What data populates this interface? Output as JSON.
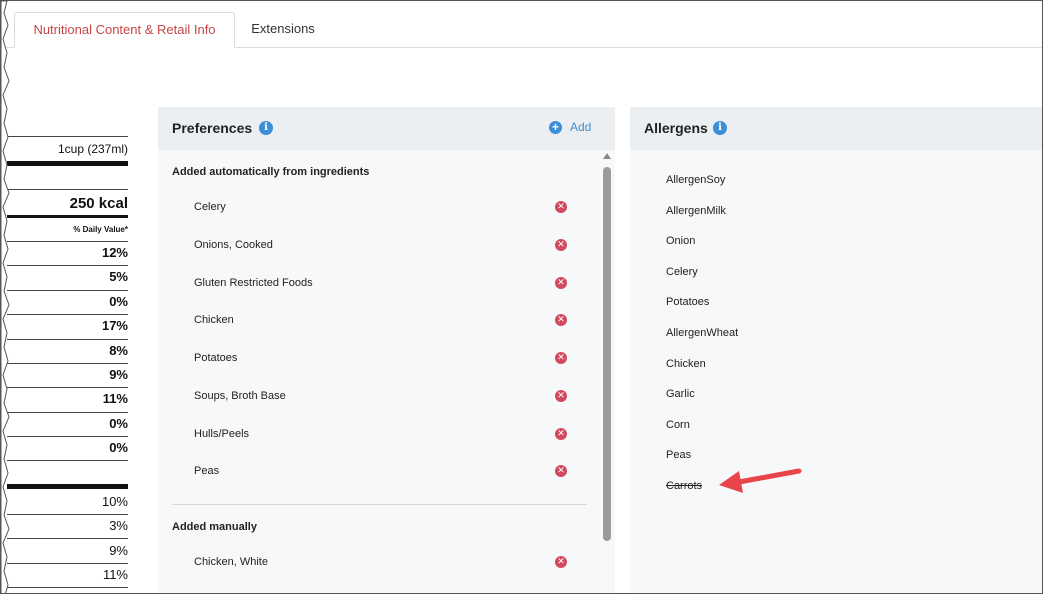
{
  "tabs": [
    {
      "label": "Nutritional Content & Retail Info",
      "active": true
    },
    {
      "label": "Extensions",
      "active": false
    }
  ],
  "nutrition": {
    "serving": "1cup (237ml)",
    "calories": "250 kcal",
    "dv_header": "% Daily Value*",
    "percents": [
      "12%",
      "5%",
      "0%",
      "17%",
      "8%",
      "9%",
      "11%",
      "0%",
      "0%"
    ],
    "percents_lower": [
      "10%",
      "3%",
      "9%",
      "11%"
    ]
  },
  "preferences": {
    "title": "Preferences",
    "add_label": "Add",
    "auto_section": "Added automatically from ingredients",
    "auto_items": [
      "Celery",
      "Onions, Cooked",
      "Gluten Restricted Foods",
      "Chicken",
      "Potatoes",
      "Soups, Broth Base",
      "Hulls/Peels",
      "Peas"
    ],
    "manual_section": "Added manually",
    "manual_items": [
      "Chicken, White"
    ]
  },
  "allergens": {
    "title": "Allergens",
    "items": [
      {
        "label": "AllergenSoy",
        "struck": false
      },
      {
        "label": "AllergenMilk",
        "struck": false
      },
      {
        "label": "Onion",
        "struck": false
      },
      {
        "label": "Celery",
        "struck": false
      },
      {
        "label": "Potatoes",
        "struck": false
      },
      {
        "label": "AllergenWheat",
        "struck": false
      },
      {
        "label": "Chicken",
        "struck": false
      },
      {
        "label": "Garlic",
        "struck": false
      },
      {
        "label": "Corn",
        "struck": false
      },
      {
        "label": "Peas",
        "struck": false
      },
      {
        "label": "Carrots",
        "struck": true
      }
    ]
  },
  "colors": {
    "accent": "#3b8fd6",
    "active_tab": "#c84545",
    "remove": "#d14a60",
    "arrow": "#e8454a"
  },
  "icons": {
    "info": "info-icon",
    "add": "plus-circle-icon",
    "remove": "remove-circle-icon",
    "annotation": "red-arrow"
  }
}
